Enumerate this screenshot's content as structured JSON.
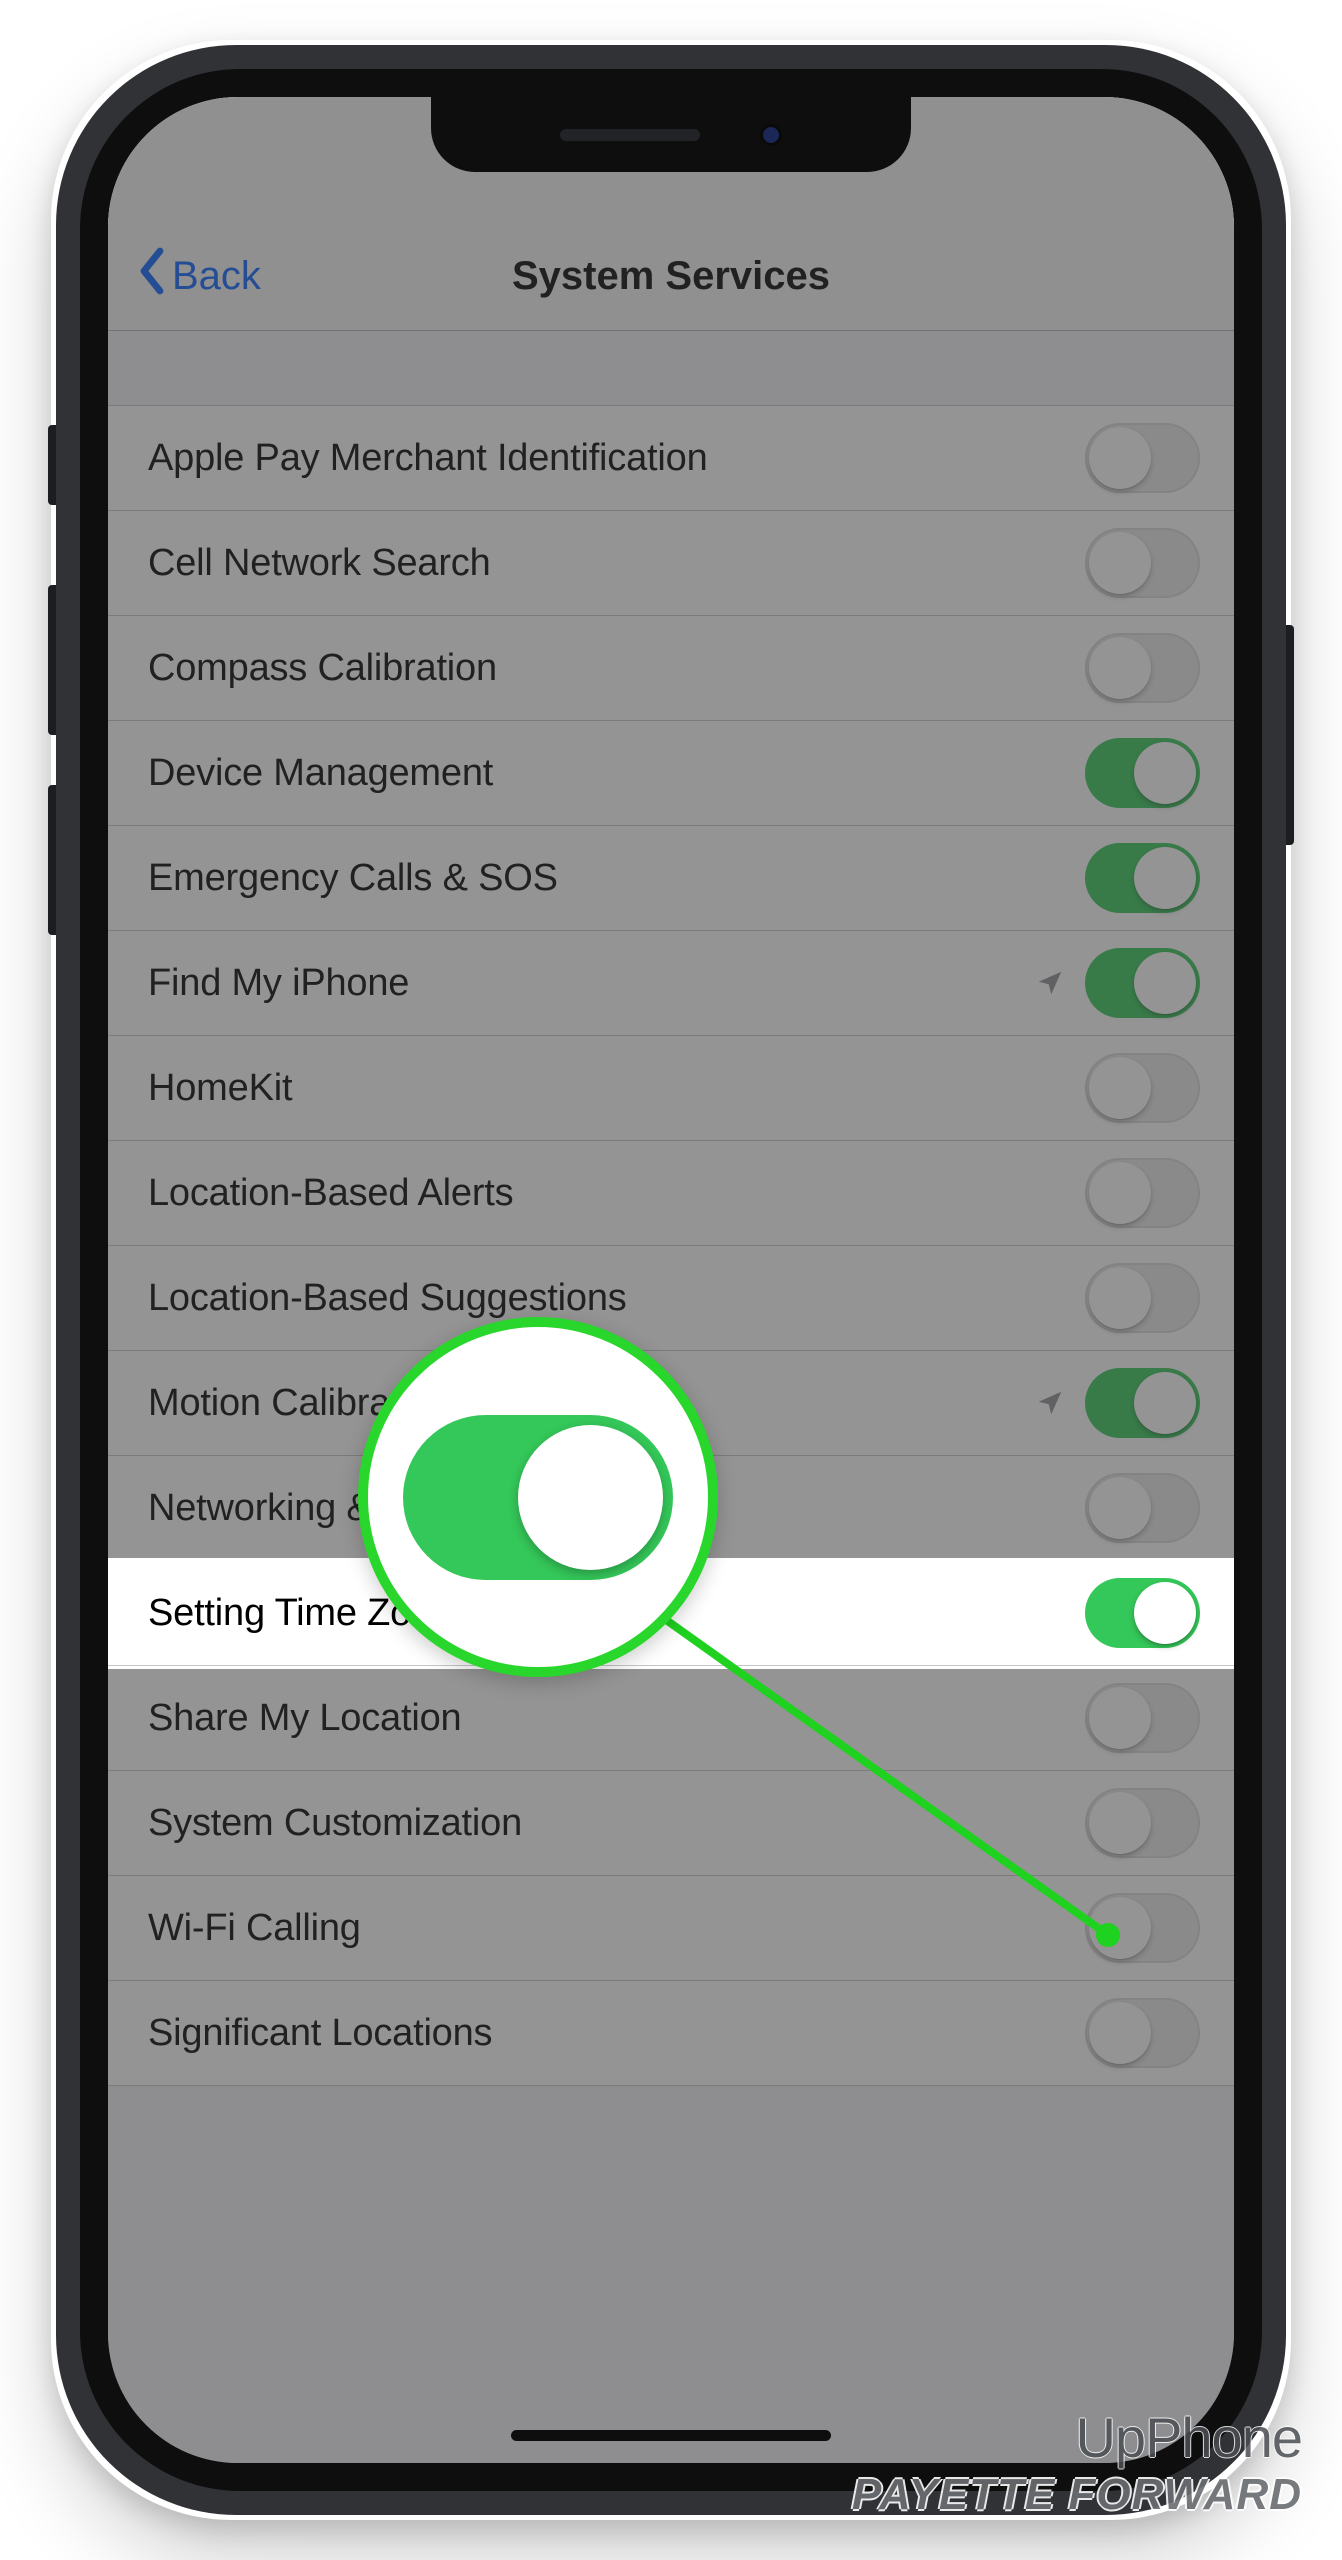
{
  "nav": {
    "back_label": "Back",
    "title": "System Services"
  },
  "rows": [
    {
      "label": "Apple Pay Merchant Identification",
      "on": false,
      "arrow": false
    },
    {
      "label": "Cell Network Search",
      "on": false,
      "arrow": false
    },
    {
      "label": "Compass Calibration",
      "on": false,
      "arrow": false
    },
    {
      "label": "Device Management",
      "on": true,
      "arrow": false
    },
    {
      "label": "Emergency Calls & SOS",
      "on": true,
      "arrow": false
    },
    {
      "label": "Find My iPhone",
      "on": true,
      "arrow": true
    },
    {
      "label": "HomeKit",
      "on": false,
      "arrow": false
    },
    {
      "label": "Location-Based Alerts",
      "on": false,
      "arrow": false
    },
    {
      "label": "Location-Based Suggestions",
      "on": false,
      "arrow": false
    },
    {
      "label": "Motion Calibration & Distance",
      "on": true,
      "arrow": true
    },
    {
      "label": "Networking & Wireless",
      "on": false,
      "arrow": false
    },
    {
      "label": "Setting Time Zone",
      "on": true,
      "arrow": false,
      "highlight": true
    },
    {
      "label": "Share My Location",
      "on": false,
      "arrow": false
    },
    {
      "label": "System Customization",
      "on": false,
      "arrow": false
    },
    {
      "label": "Wi-Fi Calling",
      "on": false,
      "arrow": false
    },
    {
      "label": "Significant Locations",
      "on": false,
      "arrow": false
    }
  ],
  "watermark": {
    "line1_a": "Up",
    "line1_b": "Phone",
    "line2": "PAYETTE FORWARD"
  },
  "colors": {
    "toggle_on": "#34c759",
    "accent_blue": "#0a62ff",
    "highlight_green": "#29d62b"
  }
}
